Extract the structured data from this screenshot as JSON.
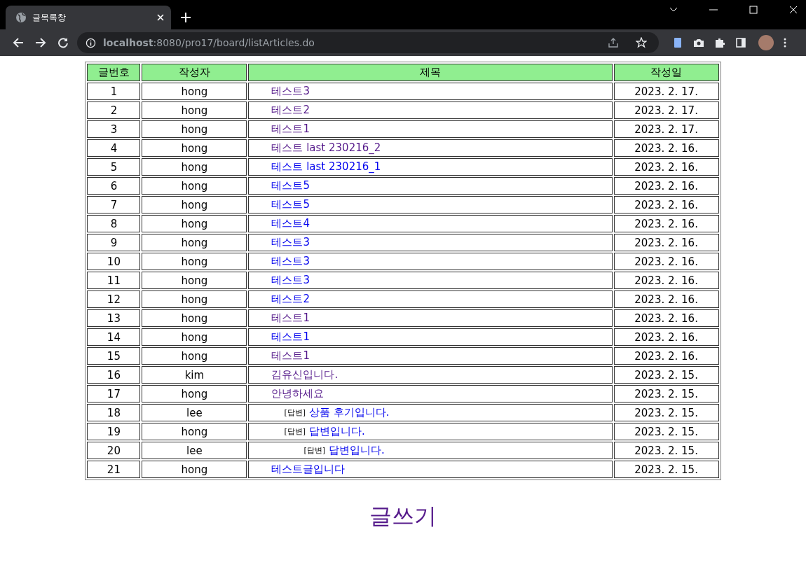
{
  "browser": {
    "tab": {
      "title": "글목록창",
      "selected": true
    },
    "address": "**localhost**:8080/pro17/board/listArticles.do"
  },
  "table": {
    "columns": [
      "글번호",
      "작성자",
      "제목",
      "작성일"
    ],
    "rows": [
      {
        "number": "1",
        "author": "hong",
        "title": "테스트3",
        "visited": true,
        "date": "2023. 2. 17."
      },
      {
        "number": "2",
        "author": "hong",
        "title": "테스트2",
        "visited": true,
        "date": "2023. 2. 17."
      },
      {
        "number": "3",
        "author": "hong",
        "title": "테스트1",
        "visited": true,
        "date": "2023. 2. 17."
      },
      {
        "number": "4",
        "author": "hong",
        "title": "테스트 last 230216_2",
        "visited": true,
        "date": "2023. 2. 16."
      },
      {
        "number": "5",
        "author": "hong",
        "title": "테스트 last 230216_1",
        "visited": false,
        "date": "2023. 2. 16."
      },
      {
        "number": "6",
        "author": "hong",
        "title": "테스트5",
        "visited": false,
        "date": "2023. 2. 16."
      },
      {
        "number": "7",
        "author": "hong",
        "title": "테스트5",
        "visited": false,
        "date": "2023. 2. 16."
      },
      {
        "number": "8",
        "author": "hong",
        "title": "테스트4",
        "visited": false,
        "date": "2023. 2. 16."
      },
      {
        "number": "9",
        "author": "hong",
        "title": "테스트3",
        "visited": false,
        "date": "2023. 2. 16."
      },
      {
        "number": "10",
        "author": "hong",
        "title": "테스트3",
        "visited": false,
        "date": "2023. 2. 16."
      },
      {
        "number": "11",
        "author": "hong",
        "title": "테스트3",
        "visited": false,
        "date": "2023. 2. 16."
      },
      {
        "number": "12",
        "author": "hong",
        "title": "테스트2",
        "visited": false,
        "date": "2023. 2. 16."
      },
      {
        "number": "13",
        "author": "hong",
        "title": "테스트1",
        "visited": true,
        "date": "2023. 2. 16."
      },
      {
        "number": "14",
        "author": "hong",
        "title": "테스트1",
        "visited": false,
        "date": "2023. 2. 16."
      },
      {
        "number": "15",
        "author": "hong",
        "title": "테스트1",
        "visited": true,
        "date": "2023. 2. 16."
      },
      {
        "number": "16",
        "author": "kim",
        "title": "김유신입니다.",
        "visited": true,
        "date": "2023. 2. 15."
      },
      {
        "number": "17",
        "author": "hong",
        "title": "안녕하세요",
        "visited": true,
        "date": "2023. 2. 15.",
        "children": [
          {
            "number": "18",
            "author": "lee",
            "reply_tag": "[답변]",
            "title": "상품 후기입니다.",
            "visited": false,
            "date": "2023. 2. 15."
          },
          {
            "number": "19",
            "author": "hong",
            "reply_tag": "[답변]",
            "title": "답변입니다.",
            "visited": false,
            "date": "2023. 2. 15.",
            "children": [
              {
                "number": "20",
                "author": "lee",
                "reply_tag": "[답변]",
                "title": "답변입니다.",
                "visited": false,
                "date": "2023. 2. 15."
              }
            ]
          }
        ]
      },
      {
        "number": "21",
        "author": "hong",
        "title": "테스트글입니다",
        "visited": false,
        "date": "2023. 2. 15."
      }
    ]
  },
  "write_link": {
    "label": "글쓰기",
    "visited": true
  }
}
